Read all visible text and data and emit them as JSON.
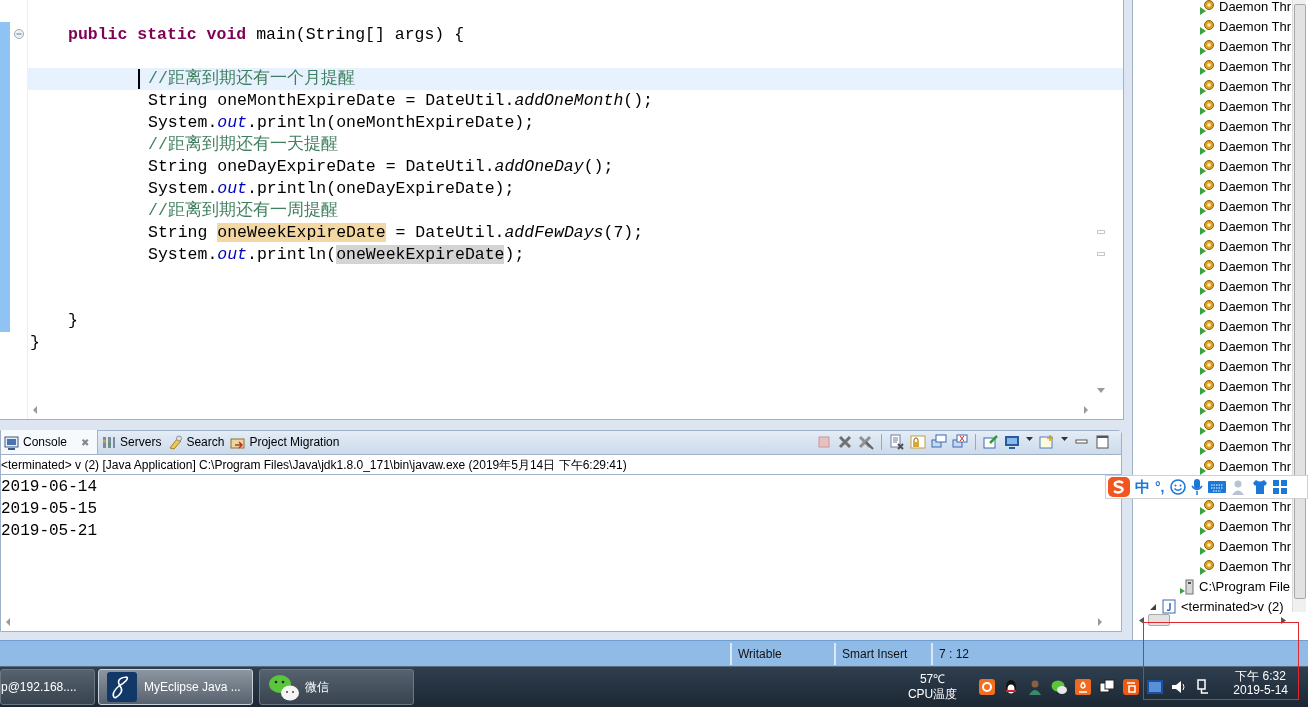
{
  "editor": {
    "method_signature": [
      {
        "kind": "keyword",
        "text": "public static void"
      },
      {
        "kind": "plain",
        "text": " main(String[] args) {"
      }
    ],
    "body": [
      {
        "current": true,
        "segments": [
          {
            "kind": "comment",
            "text": "//距离到期还有一个月提醒"
          }
        ]
      },
      {
        "current": false,
        "segments": [
          {
            "kind": "plain",
            "text": "String oneMonthExpireDate = DateUtil."
          },
          {
            "kind": "method",
            "text": "addOneMonth"
          },
          {
            "kind": "plain",
            "text": "();"
          }
        ]
      },
      {
        "current": false,
        "segments": [
          {
            "kind": "plain",
            "text": "System."
          },
          {
            "kind": "field",
            "text": "out"
          },
          {
            "kind": "plain",
            "text": ".println(oneMonthExpireDate);"
          }
        ]
      },
      {
        "current": false,
        "segments": [
          {
            "kind": "comment",
            "text": "//距离到期还有一天提醒"
          }
        ]
      },
      {
        "current": false,
        "segments": [
          {
            "kind": "plain",
            "text": "String oneDayExpireDate = DateUtil."
          },
          {
            "kind": "method",
            "text": "addOneDay"
          },
          {
            "kind": "plain",
            "text": "();"
          }
        ]
      },
      {
        "current": false,
        "segments": [
          {
            "kind": "plain",
            "text": "System."
          },
          {
            "kind": "field",
            "text": "out"
          },
          {
            "kind": "plain",
            "text": ".println(oneDayExpireDate);"
          }
        ]
      },
      {
        "current": false,
        "segments": [
          {
            "kind": "comment",
            "text": "//距离到期还有一周提醒"
          }
        ]
      },
      {
        "current": false,
        "segments": [
          {
            "kind": "plain",
            "text": "String "
          },
          {
            "kind": "write-occurrence",
            "text": "oneWeekExpireDate"
          },
          {
            "kind": "plain",
            "text": " = DateUtil."
          },
          {
            "kind": "method",
            "text": "addFewDays"
          },
          {
            "kind": "plain",
            "text": "(7);"
          }
        ]
      },
      {
        "current": false,
        "segments": [
          {
            "kind": "plain",
            "text": "System."
          },
          {
            "kind": "field",
            "text": "out"
          },
          {
            "kind": "plain",
            "text": ".println("
          },
          {
            "kind": "read-occurrence",
            "text": "oneWeekExpireDate"
          },
          {
            "kind": "plain",
            "text": ");"
          }
        ]
      }
    ],
    "method_close": "}",
    "class_close": "}"
  },
  "console": {
    "tabs": [
      {
        "label": "Console",
        "selected": true
      },
      {
        "label": "Servers",
        "selected": false
      },
      {
        "label": "Search",
        "selected": false
      },
      {
        "label": "Project Migration",
        "selected": false
      }
    ],
    "close_mark": "✖",
    "process": "<terminated> v (2) [Java Application] C:\\Program Files\\Java\\jdk1.8.0_171\\bin\\javaw.exe (2019年5月14日 下午6:29:41)",
    "output": [
      "2019-06-14",
      "2019-05-15",
      "2019-05-21"
    ]
  },
  "debug_tree": {
    "threads": [
      "Daemon Thr",
      "Daemon Thr",
      "Daemon Thr",
      "Daemon Thr",
      "Daemon Thr",
      "Daemon Thr",
      "Daemon Thr",
      "Daemon Thr",
      "Daemon Thr",
      "Daemon Thr",
      "Daemon Thr",
      "Daemon Thr",
      "Daemon Thr",
      "Daemon Thr",
      "Daemon Thr",
      "Daemon Thr",
      "Daemon Thr",
      "Daemon Thr",
      "Daemon Thr",
      "Daemon Thr",
      "Daemon Thr",
      "Daemon Thr",
      "Daemon Thr",
      "Daemon Thr"
    ],
    "threads_below": [
      "Daemon Thr",
      "Daemon Thr",
      "Daemon Thr",
      "Daemon Thr"
    ],
    "process": "C:\\Program File",
    "launch": "<terminated>v (2)"
  },
  "ime_bar": {
    "chinese": "中",
    "punctuation": "°,"
  },
  "status_bar": {
    "fields": [
      "Writable",
      "Smart Insert",
      "7 : 12"
    ]
  },
  "taskbar": {
    "buttons": [
      {
        "label": "p@192.168....",
        "selected": false
      },
      {
        "label": "MyEclipse Java ...",
        "selected": true
      },
      {
        "label": "微信",
        "selected": false
      }
    ],
    "temperature": "57℃",
    "temperature_label": "CPU温度",
    "time": "下午 6:32",
    "date": "2019-5-14"
  }
}
